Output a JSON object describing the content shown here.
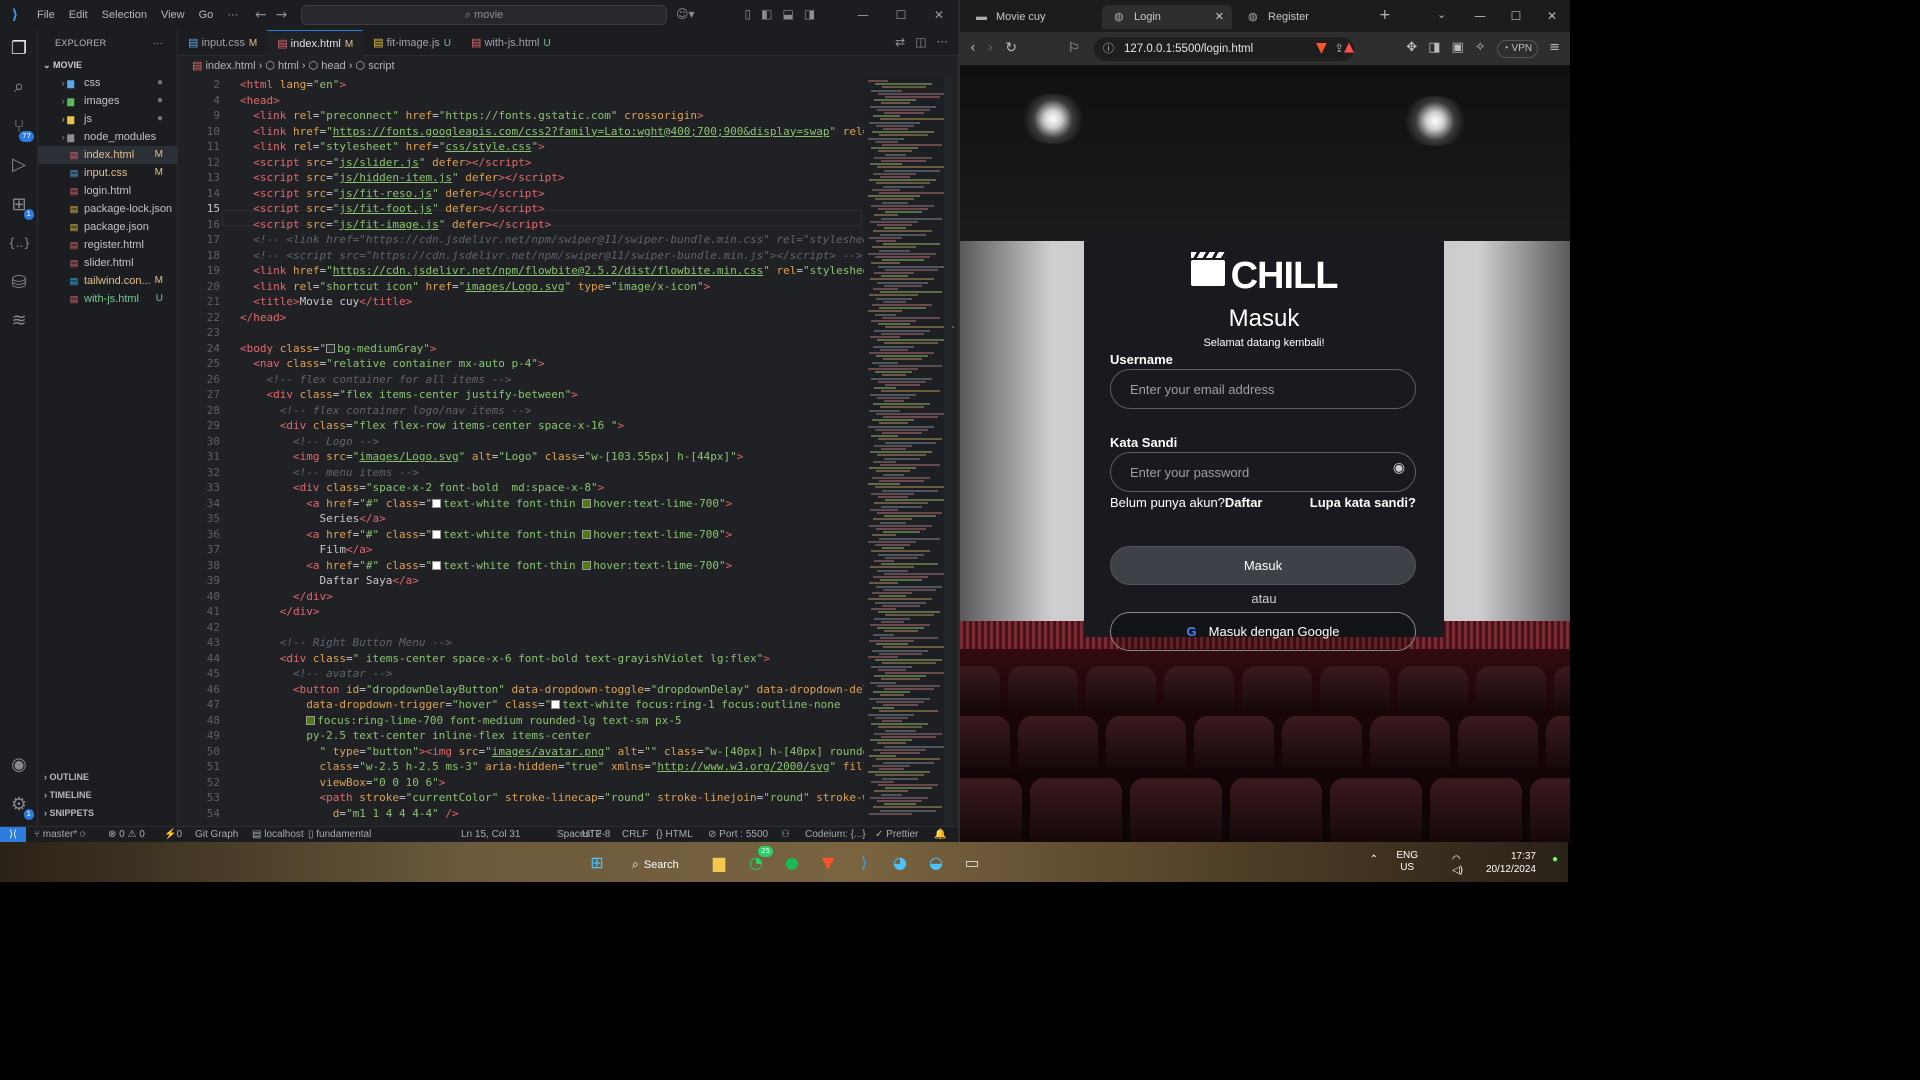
{
  "vscode": {
    "menu": [
      "File",
      "Edit",
      "Selection",
      "View",
      "Go",
      "···"
    ],
    "search_placeholder": "movie",
    "explorer": {
      "title": "EXPLORER",
      "project": "MOVIE",
      "items": [
        {
          "name": "css",
          "type": "folder",
          "status": "●",
          "color": "#5aa9e6"
        },
        {
          "name": "images",
          "type": "folder",
          "status": "●",
          "color": "#5cb85c"
        },
        {
          "name": "js",
          "type": "folder",
          "status": "●",
          "color": "#e8c547"
        },
        {
          "name": "node_modules",
          "type": "folder",
          "status": "",
          "color": "#8a8d93"
        },
        {
          "name": "index.html",
          "type": "html",
          "status": "M",
          "color": "#e5676d"
        },
        {
          "name": "input.css",
          "type": "css",
          "status": "M",
          "color": "#5aa9e6"
        },
        {
          "name": "login.html",
          "type": "html",
          "status": "",
          "color": "#e5676d"
        },
        {
          "name": "package-lock.json",
          "type": "json",
          "status": "",
          "color": "#e8c547"
        },
        {
          "name": "package.json",
          "type": "json",
          "status": "",
          "color": "#e8c547"
        },
        {
          "name": "register.html",
          "type": "html",
          "status": "",
          "color": "#e5676d"
        },
        {
          "name": "slider.html",
          "type": "html",
          "status": "",
          "color": "#e5676d"
        },
        {
          "name": "tailwind.con...",
          "type": "js",
          "status": "M",
          "color": "#38bdf8"
        },
        {
          "name": "with-js.html",
          "type": "html",
          "status": "U",
          "color": "#e5676d"
        }
      ],
      "bottom": [
        "OUTLINE",
        "TIMELINE",
        "SNIPPETS"
      ]
    },
    "tabs": [
      {
        "name": "input.css",
        "status": "M",
        "icon": "#5aa9e6"
      },
      {
        "name": "index.html",
        "status": "M",
        "icon": "#e5676d",
        "active": true
      },
      {
        "name": "fit-image.js",
        "status": "U",
        "icon": "#e8c547"
      },
      {
        "name": "with-js.html",
        "status": "U",
        "icon": "#e5676d"
      }
    ],
    "breadcrumb": [
      "index.html",
      "html",
      "head",
      "script"
    ],
    "line_numbers": [
      "2",
      "4",
      "9",
      "10",
      "11",
      "12",
      "13",
      "14",
      "15",
      "16",
      "17",
      "18",
      "19",
      "20",
      "21",
      "22",
      "23",
      "24",
      "25",
      "26",
      "27",
      "28",
      "29",
      "30",
      "31",
      "32",
      "33",
      "34",
      "35",
      "36",
      "37",
      "38",
      "39",
      "40",
      "41",
      "42",
      "43",
      "44",
      "45",
      "46",
      "47",
      "48",
      "49",
      "50",
      "51",
      "52",
      "53",
      "54"
    ],
    "current_line": "15",
    "status": {
      "branch": "master*",
      "errors": "⊗ 0 ⚠ 0",
      "ports": "⚡0",
      "gitgraph": "Git Graph",
      "server": "localhost",
      "theme": "fundamental",
      "position": "Ln 15, Col 31",
      "spaces": "Spaces: 2",
      "encoding": "UTF-8",
      "eol": "CRLF",
      "lang": "{} HTML",
      "port": "Port : 5500",
      "codeium": "Codeium: {...}",
      "prettier": "✓ Prettier"
    },
    "activity_badges": {
      "scm": "77",
      "ext": "1",
      "settings": "1"
    }
  },
  "browser": {
    "tabs": [
      {
        "title": "Movie cuy"
      },
      {
        "title": "Login",
        "active": true
      },
      {
        "title": "Register"
      }
    ],
    "url": "127.0.0.1:5500/login.html",
    "vpn": "VPN",
    "page": {
      "brand": "CHILL",
      "title": "Masuk",
      "subtitle": "Selamat datang kembali!",
      "username_label": "Username",
      "username_placeholder": "Enter your email address",
      "password_label": "Kata Sandi",
      "password_placeholder": "Enter your password",
      "no_account": "Belum punya akun?",
      "register_link": "Daftar",
      "forgot": "Lupa kata sandi?",
      "login_button": "Masuk",
      "or": "atau",
      "google_button": "Masuk dengan Google"
    }
  },
  "taskbar": {
    "search": "Search",
    "whatsapp_badge": "25",
    "lang": "ENG",
    "region": "US",
    "time": "17:37",
    "date": "20/12/2024"
  }
}
